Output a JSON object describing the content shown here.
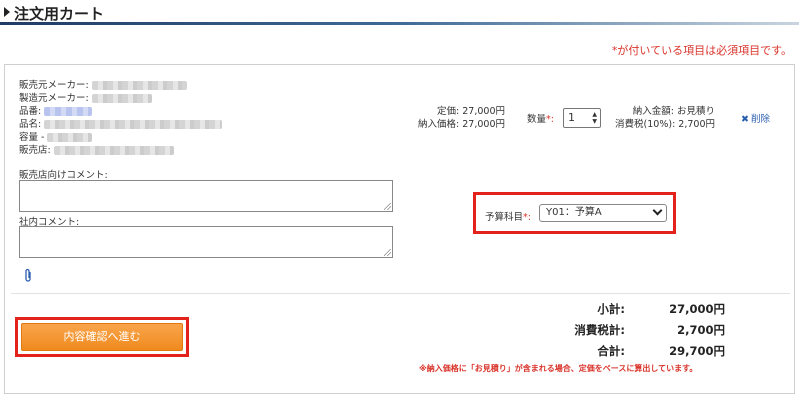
{
  "header": {
    "title": "注文用カート"
  },
  "required_note": {
    "asterisk": "*",
    "text": "が付いている項目は必須項目です。"
  },
  "product": {
    "seller_maker_label": "販売元メーカー:",
    "maker_label": "製造元メーカー:",
    "part_no_label": "品番:",
    "name_label": "品名:",
    "capacity_label": "容量 -",
    "store_label": "販売店:"
  },
  "pricing": {
    "list_price": "定価: 27,000円",
    "delivery_price": "納入価格: 27,000円",
    "quantity_label": "数量",
    "quantity_asterisk": "*:",
    "quantity_value": "1",
    "delivery_amount": "納入金額: お見積り",
    "tax": "消費税(10%): 2,700円",
    "delete_label": "削除"
  },
  "comments": {
    "store_comment_label": "販売店向けコメント:",
    "internal_comment_label": "社内コメント:"
  },
  "budget": {
    "label": "予算科目",
    "asterisk": "*:",
    "selected": "Y01：予算A"
  },
  "actions": {
    "proceed_label": "内容確認へ進む"
  },
  "totals": {
    "subtotal_label": "小計:",
    "subtotal_value": "27,000円",
    "tax_label": "消費税計:",
    "tax_value": "2,700円",
    "total_label": "合計:",
    "total_value": "29,700円"
  },
  "footnote": "※納入価格に「お見積り」が含まれる場合、定価をベースに算出しています。",
  "colors": {
    "required_red": "#d9342b",
    "highlight_red": "#e3221b",
    "button_orange": "#f39a33",
    "link_blue": "#2a5fb0"
  }
}
